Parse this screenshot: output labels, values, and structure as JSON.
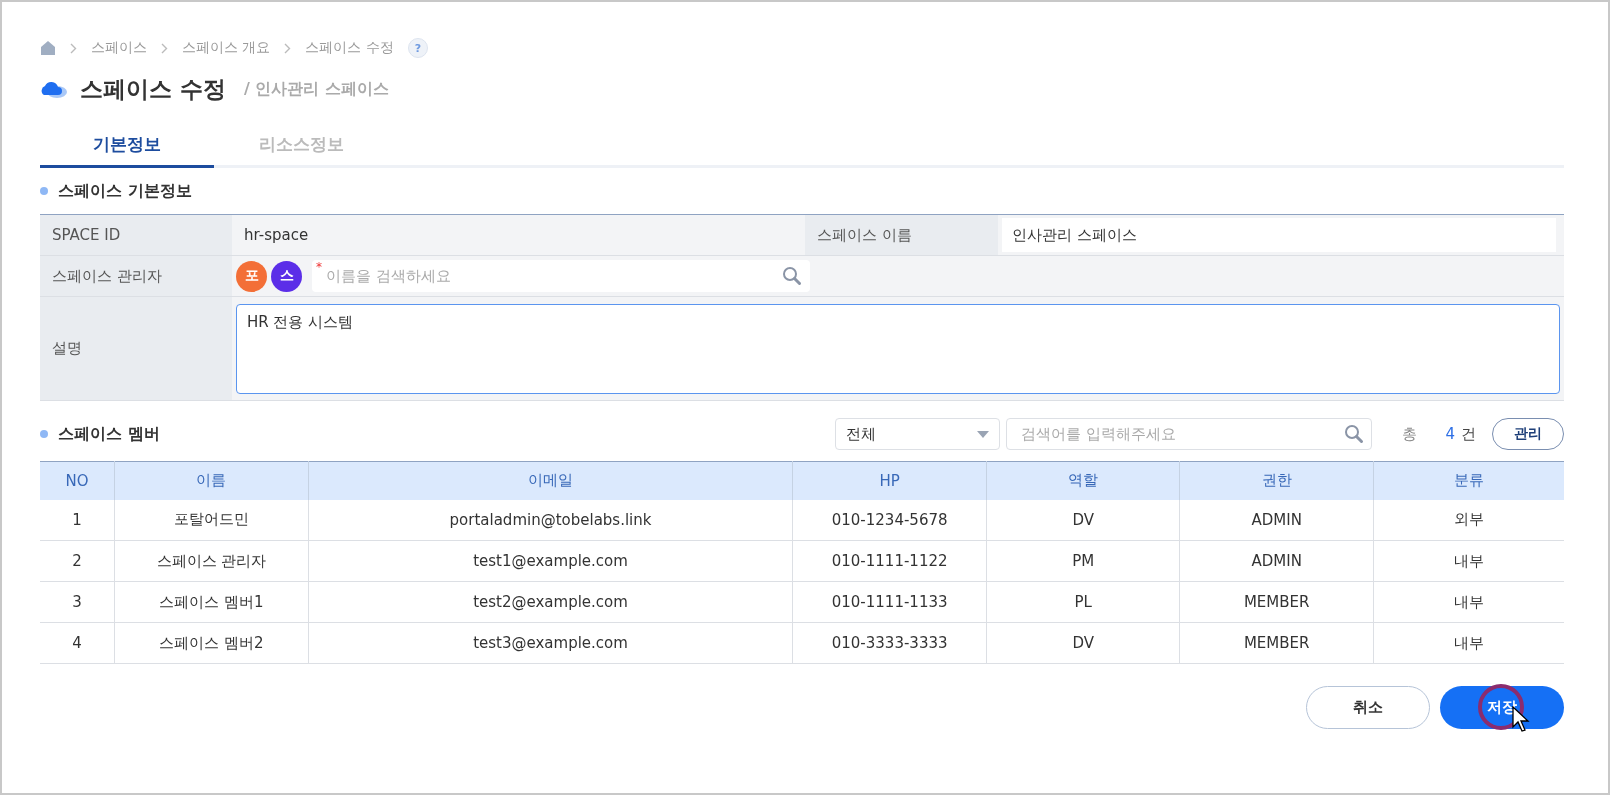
{
  "breadcrumb": {
    "items": [
      "스페이스",
      "스페이스 개요",
      "스페이스 수정"
    ]
  },
  "help": "?",
  "title": "스페이스 수정",
  "subtitle": "/ 인사관리 스페이스",
  "tabs": [
    {
      "label": "기본정보",
      "selected": true
    },
    {
      "label": "리소스정보",
      "selected": false
    }
  ],
  "basic_info": {
    "title": "스페이스 기본정보",
    "space_id_label": "SPACE ID",
    "space_id": "hr-space",
    "name_label": "스페이스 이름",
    "name": "인사관리 스페이스",
    "admin_label": "스페이스 관리자",
    "admins": [
      {
        "initial": "포",
        "color": "#f36f37"
      },
      {
        "initial": "스",
        "color": "#5b2ee8"
      }
    ],
    "admin_required": "*",
    "admin_placeholder": "이름을 검색하세요",
    "description_label": "설명",
    "description": "HR 전용 시스템"
  },
  "members": {
    "title": "스페이스 멤버",
    "filter": "전체",
    "search_placeholder": "검색어를 입력해주세요",
    "total_label": "총",
    "total_count": "4",
    "total_unit": "건",
    "manage_button": "관리",
    "columns": [
      "NO",
      "이름",
      "이메일",
      "HP",
      "역할",
      "권한",
      "분류"
    ],
    "rows": [
      [
        "1",
        "포탈어드민",
        "portaladmin@tobelabs.link",
        "010-1234-5678",
        "DV",
        "ADMIN",
        "외부"
      ],
      [
        "2",
        "스페이스 관리자",
        "test1@example.com",
        "010-1111-1122",
        "PM",
        "ADMIN",
        "내부"
      ],
      [
        "3",
        "스페이스 멤버1",
        "test2@example.com",
        "010-1111-1133",
        "PL",
        "MEMBER",
        "내부"
      ],
      [
        "4",
        "스페이스 멤버2",
        "test3@example.com",
        "010-3333-3333",
        "DV",
        "MEMBER",
        "내부"
      ]
    ]
  },
  "buttons": {
    "cancel": "취소",
    "save": "저장"
  }
}
